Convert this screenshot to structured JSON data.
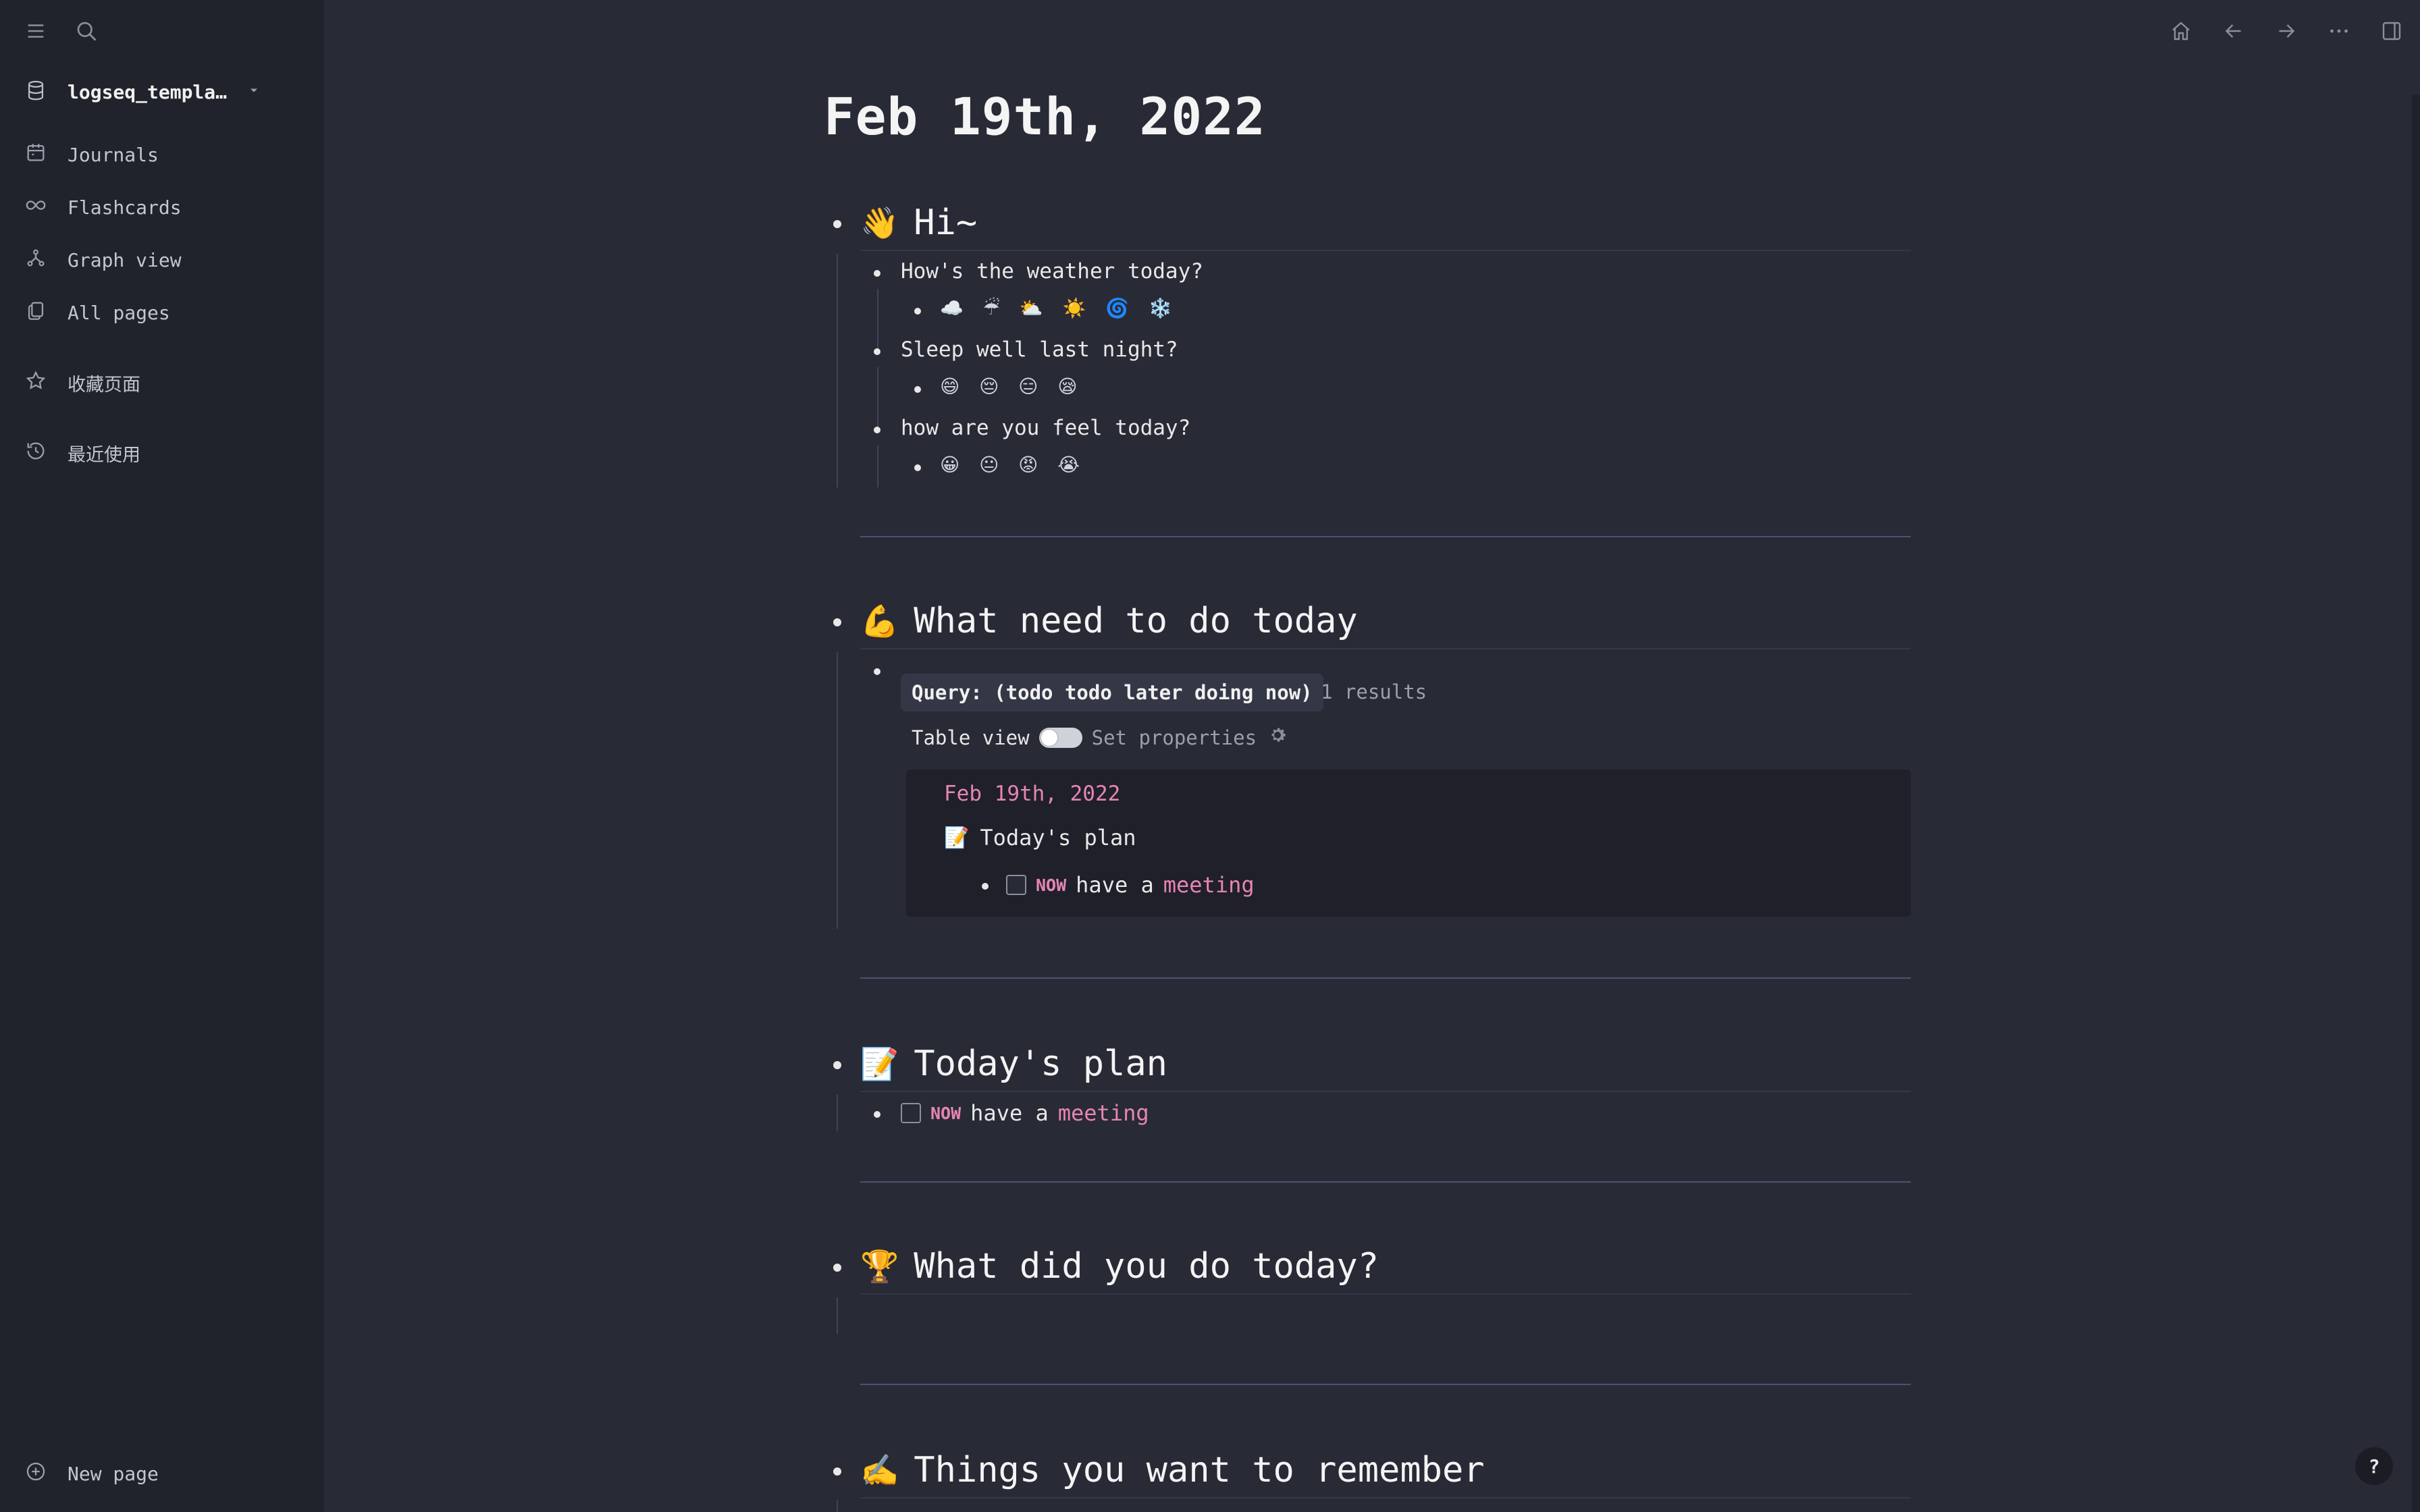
{
  "sidebar": {
    "repo_name": "logseq_templa…",
    "items": [
      {
        "label": "Journals",
        "icon": "calendar-icon"
      },
      {
        "label": "Flashcards",
        "icon": "infinity-icon"
      },
      {
        "label": "Graph view",
        "icon": "graph-icon"
      },
      {
        "label": "All pages",
        "icon": "pages-icon"
      }
    ],
    "favorites_label": "收藏页面",
    "recent_label": "最近使用",
    "new_page_label": "New page"
  },
  "page": {
    "title": "Feb 19th, 2022",
    "sections": {
      "hi": {
        "emoji": "👋",
        "title": "Hi~",
        "q1": "How's the weather today?",
        "q1_options": "☁️ ☔ ⛅ ☀️ 🌀 ❄️",
        "q2": "Sleep well last night?",
        "q2_options": "😄 😔 😑 😪",
        "q3": "how are you feel today?",
        "q3_options": "😀 😐 😡 😭"
      },
      "todo": {
        "emoji": "💪",
        "title": " What need to do today",
        "query_label": "Query: (todo todo later doing now)",
        "query_count": "1 results",
        "table_view_label": "Table view",
        "set_properties_label": "Set properties",
        "result": {
          "page": "Feb 19th, 2022",
          "parent_emoji": "📝",
          "parent": "Today's plan",
          "marker": "NOW",
          "text": "have a",
          "link": "meeting"
        }
      },
      "plan": {
        "emoji": "📝",
        "title": "Today's plan",
        "marker": "NOW",
        "text": "have a",
        "link": "meeting"
      },
      "done": {
        "emoji": "🏆",
        "title": "What did you do today?"
      },
      "remember": {
        "emoji": "✍️",
        "title": "Things you want to remember"
      }
    }
  },
  "help_label": "?",
  "colors": {
    "background": "#282a36",
    "sidebar": "#21232c",
    "accent_pink": "#e685b5"
  }
}
